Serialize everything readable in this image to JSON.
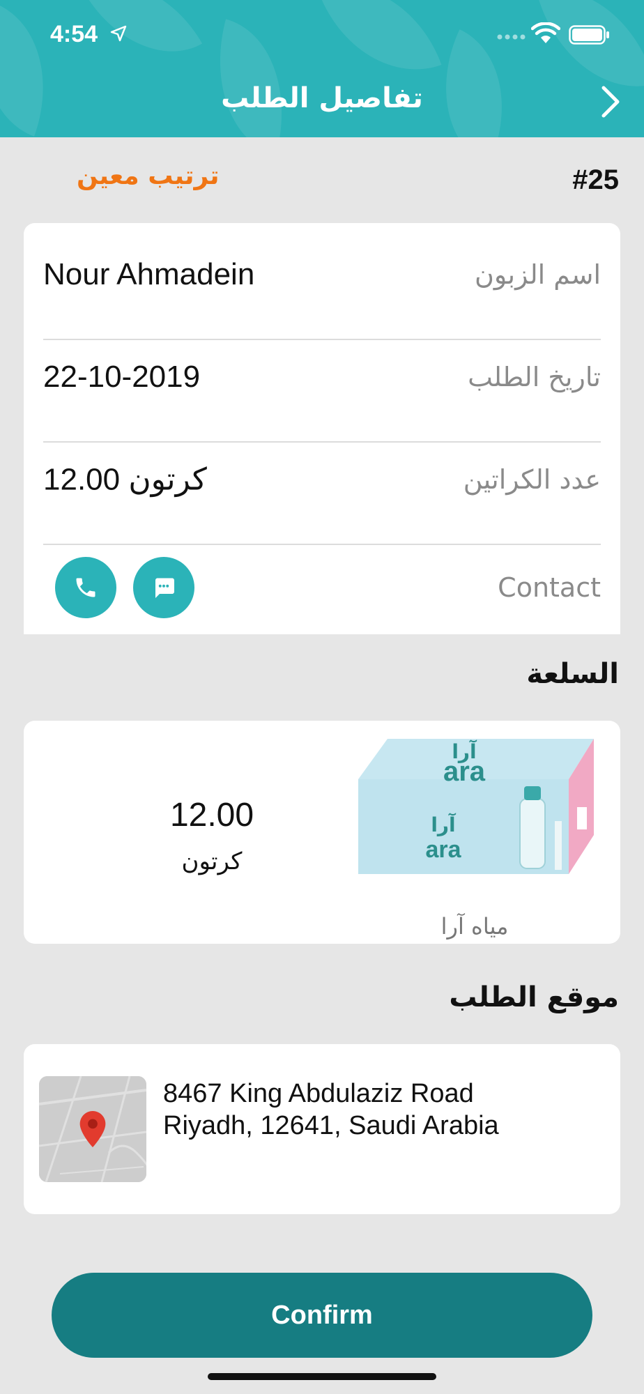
{
  "status_bar": {
    "time": "4:54"
  },
  "nav": {
    "title": "تفاصيل الطلب"
  },
  "order": {
    "id": "#25",
    "type": "ترتيب معين"
  },
  "details": {
    "customer_label": "اسم الزبون",
    "customer_value": "Nour Ahmadein",
    "date_label": "تاريخ الطلب",
    "date_value": "22-10-2019",
    "cartons_label": "عدد الكراتين",
    "cartons_value": "12.00 كرتون",
    "contact_label": "Contact"
  },
  "goods": {
    "section_title": "السلعة",
    "product_name": "مياه آرا",
    "quantity": "12.00",
    "unit": "كرتون",
    "box_brand_ar": "آرا",
    "box_brand_en": "ara"
  },
  "location": {
    "section_title": "موقع الطلب",
    "address_line1": "8467 King Abdulaziz Road",
    "address_line2": "Riyadh, 12641, Saudi Arabia"
  },
  "confirm_label": "Confirm",
  "colors": {
    "accent": "#2bb3b8",
    "confirm": "#167d82",
    "order_type": "#f07514"
  }
}
